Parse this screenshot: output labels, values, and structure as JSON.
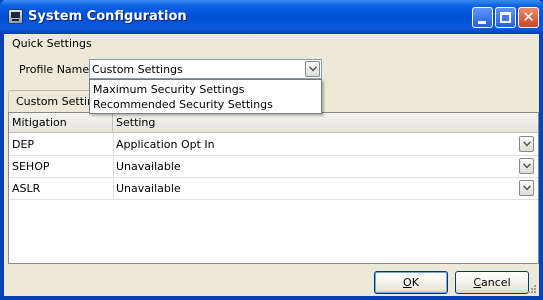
{
  "window": {
    "title": "System Configuration"
  },
  "menu": {
    "label": "Quick Settings"
  },
  "profile": {
    "label": "Profile Name",
    "selected": "Custom Settings",
    "options": [
      "Maximum Security Settings",
      "Recommended Security Settings"
    ]
  },
  "tab": {
    "label": "Custom Settings"
  },
  "table": {
    "headers": [
      "Mitigation",
      "Setting"
    ],
    "rows": [
      {
        "mitigation": "DEP",
        "setting": "Application Opt In"
      },
      {
        "mitigation": "SEHOP",
        "setting": "Unavailable"
      },
      {
        "mitigation": "ASLR",
        "setting": "Unavailable"
      }
    ]
  },
  "buttons": {
    "ok": {
      "mnemonic": "O",
      "rest": "K"
    },
    "cancel": {
      "mnemonic": "C",
      "rest": "ancel"
    }
  },
  "colors": {
    "titlebar": "#0050d6",
    "window_bg": "#ece9d8",
    "close_button": "#c9462a"
  },
  "icons": [
    "app-icon",
    "minimize-icon",
    "maximize-icon",
    "close-icon",
    "chevron-down-icon",
    "resize-grip-icon"
  ]
}
